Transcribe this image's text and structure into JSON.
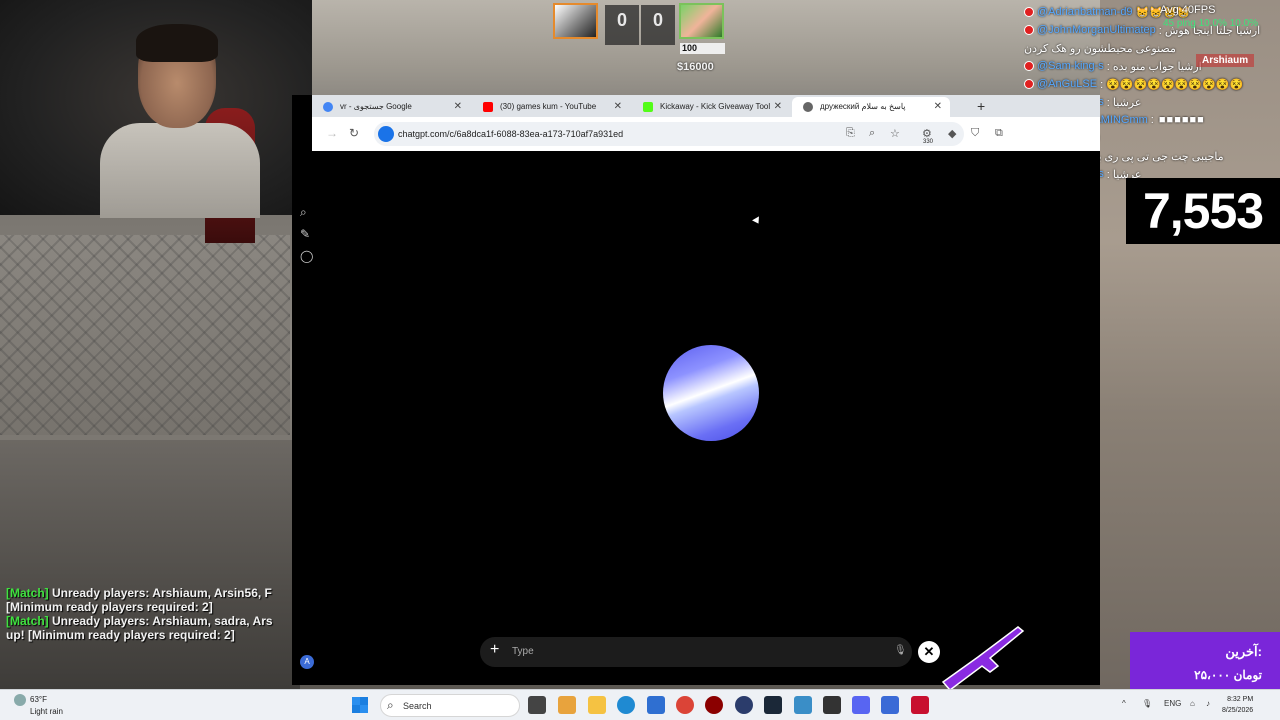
{
  "hud": {
    "score_ct": "0",
    "score_t": "0",
    "health": "100",
    "money": "$16000"
  },
  "overlay": {
    "fps": "Avg  40FPS",
    "ping": "45 ping  10.0%  10.0%",
    "player_label": "Arshiaum",
    "viewers": "7,553",
    "chat": [
      {
        "user": "@Adrianbatman-d9",
        "msg": " 😸😸😸😸"
      },
      {
        "user": "@JohnMorganUltimatep",
        "msg": " : ارشیا جلتا اینجا هوش"
      },
      {
        "user": "",
        "msg": "مصنوعی محیطشون رو هک کردن"
      },
      {
        "user": "@Sam-king-s",
        "msg": " : ارشیا جواب منو بده"
      },
      {
        "user": "@AnGuLSE",
        "msg": " : 😵😵😵😵😵😵😵😵😵😵"
      },
      {
        "user": "@Sam-king-s",
        "msg": " : عرشیا"
      },
      {
        "user": "@SOLO_GAMINGmm",
        "msg": " : ■■■■■■"
      },
      {
        "user": "",
        "msg": "■■■■■■■■■■"
      },
      {
        "user": "@zx26x",
        "msg": " : ماجیبی چت جی تی پی ری بهم"
      },
      {
        "user": "@Sam-king-s",
        "msg": " : عرشیا"
      }
    ],
    "match_lines": [
      {
        "tag": "[Match]",
        "text": " Unready players: Arshiaum, Arsin56, F"
      },
      {
        "tag": "",
        "text": "[Minimum ready players required: 2]"
      },
      {
        "tag": "[Match]",
        "text": " Unready players: Arshiaum, sadra, Ars"
      },
      {
        "tag": "",
        "text": "up! [Minimum ready players required: 2]"
      }
    ],
    "donation": {
      "title": "آخرین:",
      "amount": "۲۵،۰۰۰ تومان"
    }
  },
  "browser": {
    "tabs": [
      {
        "label": "vr - جستجوی Google",
        "icon_color": "#4285f4"
      },
      {
        "label": "(30) games kum - YouTube",
        "icon_color": "#ff0000"
      },
      {
        "label": "Kickaway - Kick Giveaway Tool",
        "icon_color": "#53fc18"
      },
      {
        "label": "дружеский پاسخ به سلام",
        "icon_color": "#666666"
      }
    ],
    "url": "chatgpt.com/c/6a8dca1f-6088-83ea-a173-710af7a931ed",
    "toolbar_badge": "330",
    "composer_placeholder": "Type",
    "account_initial": "A"
  },
  "taskbar": {
    "weather_temp": "63°F",
    "weather_desc": "Light rain",
    "search_label": "Search",
    "lang": "ENG",
    "time": "8:32 PM",
    "date": "8/25/2026",
    "notification_count": "1"
  }
}
